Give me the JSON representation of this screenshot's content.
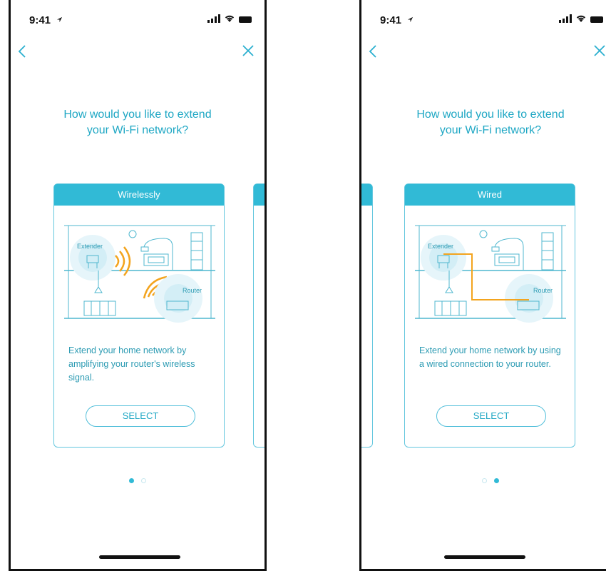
{
  "screens": [
    {
      "status_time": "9:41",
      "question_line1": "How would you like to extend",
      "question_line2": "your Wi-Fi network?",
      "card_title": "Wirelessly",
      "illustration_labels": {
        "extender": "Extender",
        "router": "Router"
      },
      "description": "Extend your home network by amplifying your router's wireless signal.",
      "select_label": "SELECT",
      "active_page": 1
    },
    {
      "status_time": "9:41",
      "question_line1": "How would you like to extend",
      "question_line2": "your Wi-Fi network?",
      "card_title": "Wired",
      "illustration_labels": {
        "extender": "Extender",
        "router": "Router"
      },
      "description": "Extend your home network by using a wired connection to your router.",
      "select_label": "SELECT",
      "active_page": 2
    }
  ],
  "page_count": 2,
  "colors": {
    "accent": "#31bad6",
    "wave": "#f3a41e",
    "text": "#1ea7c4"
  },
  "icons": [
    "location-arrow-icon",
    "signal-icon",
    "wifi-icon",
    "battery-icon",
    "back-chevron-icon",
    "close-icon"
  ]
}
